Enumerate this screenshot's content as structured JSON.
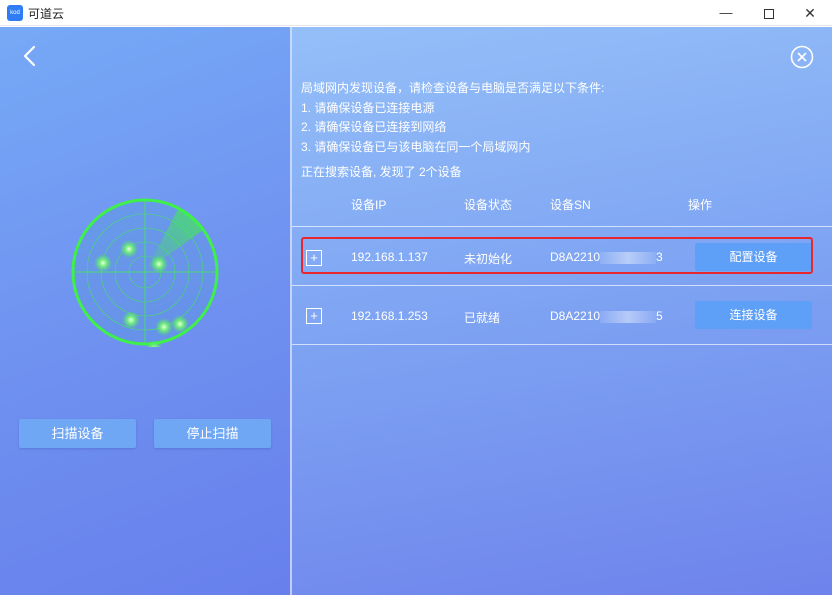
{
  "window": {
    "title": "可道云",
    "icon_text": "kod",
    "minimize_glyph": "—",
    "close_glyph": "✕"
  },
  "scan": {
    "start_label": "扫描设备",
    "stop_label": "停止扫描"
  },
  "info": {
    "lines": [
      "局域网内发现设备，请检查设备与电脑是否满足以下条件:",
      "1. 请确保设备已连接电源",
      "2. 请确保设备已连接到网络",
      "3. 请确保设备已与该电脑在同一个局域网内"
    ],
    "status": "正在搜索设备, 发现了 2个设备"
  },
  "table": {
    "headers": [
      "设备IP",
      "设备状态",
      "设备SN",
      "操作"
    ],
    "rows": [
      {
        "ip": "192.168.1.137",
        "state": "未初始化",
        "sn_prefix": "D8A2210",
        "sn_suffix": "3",
        "action": "配置设备",
        "expand": "+"
      },
      {
        "ip": "192.168.1.253",
        "state": "已就绪",
        "sn_prefix": "D8A2210",
        "sn_suffix": "5",
        "action": "连接设备",
        "expand": "+"
      }
    ]
  },
  "colors": {
    "radar": "#3ff04a",
    "highlight": "#e8262e",
    "button": "#5ea0f7"
  }
}
